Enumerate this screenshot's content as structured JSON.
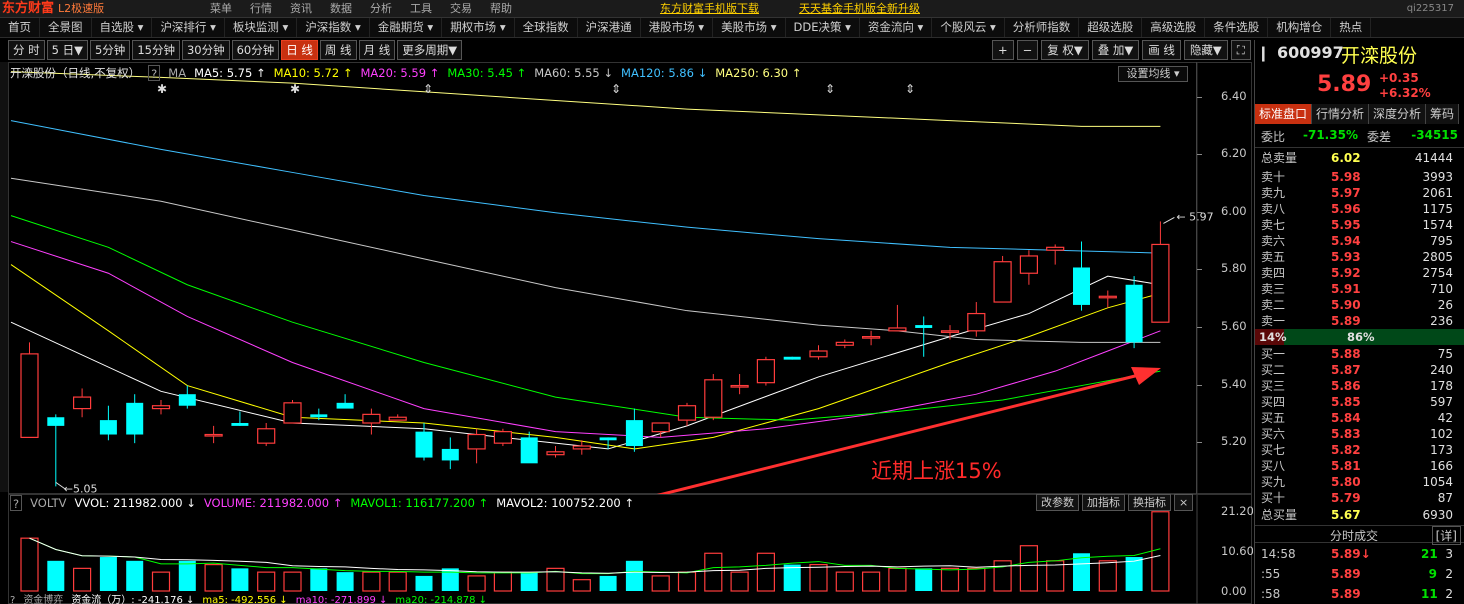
{
  "titlebar": {
    "logo": "东方财富",
    "edition": "L2极速版",
    "menu": [
      "菜单",
      "行情",
      "资讯",
      "数据",
      "分析",
      "工具",
      "交易",
      "帮助"
    ],
    "promo": [
      "东方财富手机版下载",
      "天天基金手机版全新升级"
    ],
    "code": "qi225317"
  },
  "menubar": [
    "首页",
    "全景图",
    "自选股 ▾",
    "沪深排行 ▾",
    "板块监测 ▾",
    "沪深指数 ▾",
    "金融期货 ▾",
    "期权市场 ▾",
    "全球指数",
    "沪深港通",
    "港股市场 ▾",
    "美股市场 ▾",
    "DDE决策 ▾",
    "资金流向 ▾",
    "个股风云 ▾",
    "分析师指数",
    "超级选股",
    "高级选股",
    "条件选股",
    "机构增仓",
    "热点"
  ],
  "periods": [
    "分 时",
    "5 日▼",
    "5分钟",
    "15分钟",
    "30分钟",
    "60分钟",
    "日 线",
    "周 线",
    "月 线",
    "更多周期▼"
  ],
  "active_period": "日 线",
  "controls": [
    "+",
    "−",
    "复 权▼",
    "叠 加▼",
    "画 线",
    "隐藏▼",
    "⛶"
  ],
  "chart": {
    "stock_label": "开滦股份（日线,不复权）",
    "q": "?",
    "ma_prefix": "MA",
    "ma": [
      {
        "t": "MA5: 5.75 ↑",
        "c": "#ffffff"
      },
      {
        "t": "MA10: 5.72 ↑",
        "c": "#ffff00"
      },
      {
        "t": "MA20: 5.59 ↑",
        "c": "#ff40ff"
      },
      {
        "t": "MA30: 5.45 ↑",
        "c": "#00ff00"
      },
      {
        "t": "MA60: 5.55 ↓",
        "c": "#c8c8c8"
      },
      {
        "t": "MA120: 5.86 ↓",
        "c": "#40c0ff"
      },
      {
        "t": "MA250: 6.30 ↑",
        "c": "#ffff80"
      }
    ],
    "set_ma": "设置均线 ▾",
    "price_ticks": [
      "6.40",
      "6.20",
      "6.00",
      "5.80",
      "5.60",
      "5.40",
      "5.20"
    ],
    "high_mark": "5.97",
    "low_mark": "5.05",
    "annotation": "近期上涨15%"
  },
  "chart_data": {
    "type": "candlestick",
    "ylim": [
      5.02,
      6.52
    ],
    "candles": [
      {
        "o": 5.22,
        "h": 5.55,
        "l": 5.22,
        "c": 5.51
      },
      {
        "o": 5.29,
        "h": 5.3,
        "l": 5.05,
        "c": 5.26
      },
      {
        "o": 5.32,
        "h": 5.39,
        "l": 5.29,
        "c": 5.36
      },
      {
        "o": 5.28,
        "h": 5.33,
        "l": 5.21,
        "c": 5.23
      },
      {
        "o": 5.34,
        "h": 5.37,
        "l": 5.2,
        "c": 5.23
      },
      {
        "o": 5.32,
        "h": 5.35,
        "l": 5.3,
        "c": 5.33
      },
      {
        "o": 5.37,
        "h": 5.4,
        "l": 5.32,
        "c": 5.33
      },
      {
        "o": 5.23,
        "h": 5.26,
        "l": 5.2,
        "c": 5.23
      },
      {
        "o": 5.27,
        "h": 5.31,
        "l": 5.26,
        "c": 5.26
      },
      {
        "o": 5.2,
        "h": 5.27,
        "l": 5.19,
        "c": 5.25
      },
      {
        "o": 5.27,
        "h": 5.35,
        "l": 5.27,
        "c": 5.34
      },
      {
        "o": 5.3,
        "h": 5.32,
        "l": 5.28,
        "c": 5.29
      },
      {
        "o": 5.34,
        "h": 5.37,
        "l": 5.33,
        "c": 5.32
      },
      {
        "o": 5.27,
        "h": 5.32,
        "l": 5.23,
        "c": 5.3
      },
      {
        "o": 5.28,
        "h": 5.3,
        "l": 5.28,
        "c": 5.29
      },
      {
        "o": 5.24,
        "h": 5.27,
        "l": 5.14,
        "c": 5.15
      },
      {
        "o": 5.18,
        "h": 5.22,
        "l": 5.11,
        "c": 5.14
      },
      {
        "o": 5.18,
        "h": 5.25,
        "l": 5.13,
        "c": 5.23
      },
      {
        "o": 5.2,
        "h": 5.25,
        "l": 5.19,
        "c": 5.24
      },
      {
        "o": 5.22,
        "h": 5.24,
        "l": 5.14,
        "c": 5.13
      },
      {
        "o": 5.16,
        "h": 5.19,
        "l": 5.15,
        "c": 5.17
      },
      {
        "o": 5.18,
        "h": 5.21,
        "l": 5.16,
        "c": 5.19
      },
      {
        "o": 5.22,
        "h": 5.22,
        "l": 5.18,
        "c": 5.21
      },
      {
        "o": 5.28,
        "h": 5.32,
        "l": 5.17,
        "c": 5.19
      },
      {
        "o": 5.24,
        "h": 5.27,
        "l": 5.22,
        "c": 5.27
      },
      {
        "o": 5.28,
        "h": 5.34,
        "l": 5.26,
        "c": 5.33
      },
      {
        "o": 5.29,
        "h": 5.44,
        "l": 5.28,
        "c": 5.42
      },
      {
        "o": 5.4,
        "h": 5.44,
        "l": 5.37,
        "c": 5.4
      },
      {
        "o": 5.41,
        "h": 5.5,
        "l": 5.4,
        "c": 5.49
      },
      {
        "o": 5.5,
        "h": 5.5,
        "l": 5.49,
        "c": 5.49
      },
      {
        "o": 5.5,
        "h": 5.54,
        "l": 5.49,
        "c": 5.52
      },
      {
        "o": 5.54,
        "h": 5.56,
        "l": 5.53,
        "c": 5.55
      },
      {
        "o": 5.57,
        "h": 5.59,
        "l": 5.54,
        "c": 5.57
      },
      {
        "o": 5.59,
        "h": 5.68,
        "l": 5.59,
        "c": 5.6
      },
      {
        "o": 5.61,
        "h": 5.64,
        "l": 5.5,
        "c": 5.6
      },
      {
        "o": 5.59,
        "h": 5.61,
        "l": 5.56,
        "c": 5.59
      },
      {
        "o": 5.59,
        "h": 5.69,
        "l": 5.57,
        "c": 5.65
      },
      {
        "o": 5.69,
        "h": 5.85,
        "l": 5.69,
        "c": 5.83
      },
      {
        "o": 5.79,
        "h": 5.87,
        "l": 5.75,
        "c": 5.85
      },
      {
        "o": 5.87,
        "h": 5.89,
        "l": 5.82,
        "c": 5.88
      },
      {
        "o": 5.81,
        "h": 5.9,
        "l": 5.66,
        "c": 5.68
      },
      {
        "o": 5.71,
        "h": 5.73,
        "l": 5.67,
        "c": 5.71
      },
      {
        "o": 5.75,
        "h": 5.78,
        "l": 5.53,
        "c": 5.55
      },
      {
        "o": 5.62,
        "h": 5.97,
        "l": 5.62,
        "c": 5.89
      }
    ],
    "ma_series": [
      {
        "name": "MA5",
        "color": "#ffffff",
        "pts": [
          [
            0,
            5.62
          ],
          [
            5,
            5.38
          ],
          [
            10,
            5.27
          ],
          [
            15,
            5.25
          ],
          [
            20,
            5.2
          ],
          [
            22,
            5.18
          ],
          [
            25,
            5.26
          ],
          [
            30,
            5.43
          ],
          [
            35,
            5.57
          ],
          [
            38,
            5.65
          ],
          [
            41,
            5.78
          ],
          [
            43,
            5.75
          ]
        ]
      },
      {
        "name": "MA10",
        "color": "#ffff00",
        "pts": [
          [
            0,
            5.82
          ],
          [
            3,
            5.59
          ],
          [
            6,
            5.4
          ],
          [
            10,
            5.29
          ],
          [
            15,
            5.27
          ],
          [
            20,
            5.22
          ],
          [
            23,
            5.18
          ],
          [
            26,
            5.22
          ],
          [
            30,
            5.32
          ],
          [
            35,
            5.48
          ],
          [
            38,
            5.57
          ],
          [
            41,
            5.67
          ],
          [
            43,
            5.72
          ]
        ]
      },
      {
        "name": "MA20",
        "color": "#ff40ff",
        "pts": [
          [
            0,
            5.9
          ],
          [
            3,
            5.79
          ],
          [
            6,
            5.64
          ],
          [
            10,
            5.48
          ],
          [
            15,
            5.32
          ],
          [
            20,
            5.24
          ],
          [
            24,
            5.22
          ],
          [
            28,
            5.25
          ],
          [
            32,
            5.3
          ],
          [
            36,
            5.37
          ],
          [
            39,
            5.45
          ],
          [
            41,
            5.52
          ],
          [
            43,
            5.59
          ]
        ]
      },
      {
        "name": "MA30",
        "color": "#00ff00",
        "pts": [
          [
            0,
            5.99
          ],
          [
            3,
            5.88
          ],
          [
            6,
            5.75
          ],
          [
            10,
            5.62
          ],
          [
            15,
            5.48
          ],
          [
            20,
            5.36
          ],
          [
            25,
            5.29
          ],
          [
            29,
            5.28
          ],
          [
            33,
            5.31
          ],
          [
            37,
            5.35
          ],
          [
            40,
            5.4
          ],
          [
            43,
            5.45
          ]
        ]
      },
      {
        "name": "MA60",
        "color": "#c8c8c8",
        "pts": [
          [
            0,
            6.12
          ],
          [
            5,
            6.04
          ],
          [
            10,
            5.94
          ],
          [
            15,
            5.84
          ],
          [
            20,
            5.74
          ],
          [
            25,
            5.66
          ],
          [
            30,
            5.61
          ],
          [
            33,
            5.59
          ],
          [
            36,
            5.56
          ],
          [
            40,
            5.55
          ],
          [
            43,
            5.55
          ]
        ]
      },
      {
        "name": "MA120",
        "color": "#40c0ff",
        "pts": [
          [
            0,
            6.32
          ],
          [
            5,
            6.22
          ],
          [
            10,
            6.14
          ],
          [
            15,
            6.06
          ],
          [
            20,
            6.0
          ],
          [
            25,
            5.95
          ],
          [
            30,
            5.91
          ],
          [
            35,
            5.88
          ],
          [
            39,
            5.87
          ],
          [
            43,
            5.86
          ]
        ]
      },
      {
        "name": "MA250",
        "color": "#ffff80",
        "pts": [
          [
            0,
            6.49
          ],
          [
            5,
            6.47
          ],
          [
            10,
            6.45
          ],
          [
            15,
            6.42
          ],
          [
            20,
            6.39
          ],
          [
            25,
            6.36
          ],
          [
            30,
            6.34
          ],
          [
            35,
            6.32
          ],
          [
            40,
            6.3
          ],
          [
            43,
            6.3
          ]
        ]
      }
    ],
    "volume": {
      "ylim": [
        0,
        21.2
      ],
      "ticks": [
        "21.20",
        "10.60",
        "0.00"
      ],
      "values": [
        14,
        8,
        6,
        9,
        8,
        5,
        8,
        7,
        6,
        5,
        5,
        6,
        5,
        5,
        5,
        4,
        6,
        4,
        5,
        5,
        6,
        3,
        4,
        8,
        4,
        5,
        10,
        5,
        10,
        7,
        7,
        5,
        5,
        6,
        6,
        6,
        6,
        8,
        12,
        8,
        10,
        8,
        9,
        21
      ]
    }
  },
  "volume_row": {
    "q": "?",
    "label": "VOLTV",
    "items": [
      {
        "t": "VVOL: 211982.000 ↓",
        "c": "#ffffff"
      },
      {
        "t": "VOLUME: 211982.000 ↑",
        "c": "#ff40ff"
      },
      {
        "t": "MAVOL1: 116177.200 ↑",
        "c": "#00ff00"
      },
      {
        "t": "MAVOL2: 100752.200 ↑",
        "c": "#ffffff"
      }
    ]
  },
  "volume_buttons": [
    "改参数",
    "加指标",
    "换指标",
    "×"
  ],
  "fund_row": {
    "q": "?",
    "label": "资金博弈",
    "items": [
      {
        "t": "资金流（万）: -241.176 ↓",
        "c": "#ffffff"
      },
      {
        "t": "ma5: -492.556 ↓",
        "c": "#ffff00"
      },
      {
        "t": "ma10: -271.899 ↓",
        "c": "#ff40ff"
      },
      {
        "t": "ma20: -214.878 ↓",
        "c": "#00ff00"
      }
    ]
  },
  "fund_buttons": [
    "改参数",
    "加指标",
    "换指标"
  ],
  "right": {
    "code": "600997",
    "name": "开滦股份",
    "price": "5.89",
    "change": "+0.35",
    "change_pct": "+6.32%",
    "tabs": [
      "标准盘口",
      "行情分析",
      "深度分析",
      "筹码"
    ],
    "weibi_label": "委比",
    "weibi": "-71.35%",
    "weicha_label": "委差",
    "weicha": "-34515",
    "total_sell_label": "总卖量",
    "total_sell_price": "6.02",
    "total_sell_vol": "41444",
    "asks": [
      [
        "卖十",
        "5.98",
        "3993"
      ],
      [
        "卖九",
        "5.97",
        "2061"
      ],
      [
        "卖八",
        "5.96",
        "1175"
      ],
      [
        "卖七",
        "5.95",
        "1574"
      ],
      [
        "卖六",
        "5.94",
        "795"
      ],
      [
        "卖五",
        "5.93",
        "2805"
      ],
      [
        "卖四",
        "5.92",
        "2754"
      ],
      [
        "卖三",
        "5.91",
        "710"
      ],
      [
        "卖二",
        "5.90",
        "26"
      ],
      [
        "卖一",
        "5.89",
        "236"
      ]
    ],
    "ratio_left": "14%",
    "ratio_right": "86%",
    "bids": [
      [
        "买一",
        "5.88",
        "75"
      ],
      [
        "买二",
        "5.87",
        "240"
      ],
      [
        "买三",
        "5.86",
        "178"
      ],
      [
        "买四",
        "5.85",
        "597"
      ],
      [
        "买五",
        "5.84",
        "42"
      ],
      [
        "买六",
        "5.83",
        "102"
      ],
      [
        "买七",
        "5.82",
        "173"
      ],
      [
        "买八",
        "5.81",
        "166"
      ],
      [
        "买九",
        "5.80",
        "1054"
      ],
      [
        "买十",
        "5.79",
        "87"
      ]
    ],
    "total_buy_label": "总买量",
    "total_buy_price": "5.67",
    "total_buy_vol": "6930",
    "ticks_title": "分时成交",
    "ticks_detail": "[详]",
    "ticks": [
      [
        "14:58",
        "5.89↓",
        "21",
        "3"
      ],
      [
        ":55",
        "5.89",
        "9",
        "2"
      ],
      [
        ":58",
        "5.89",
        "11",
        "2"
      ]
    ]
  }
}
